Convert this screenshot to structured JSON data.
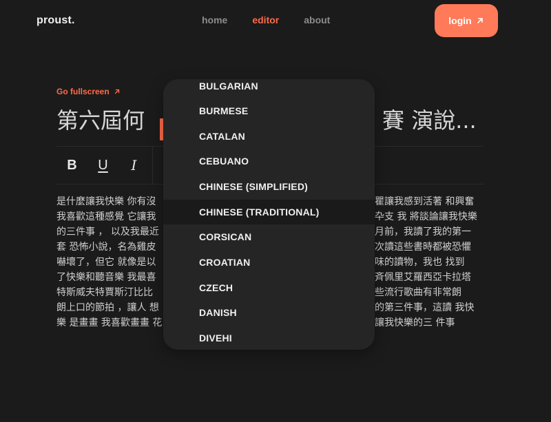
{
  "header": {
    "brand": "proust.",
    "nav": [
      {
        "label": "home",
        "active": false
      },
      {
        "label": "editor",
        "active": true
      },
      {
        "label": "about",
        "active": false
      }
    ],
    "login_label": "login",
    "login_icon": "arrow-up-right-icon"
  },
  "editor": {
    "fullscreen_label": "Go fullscreen",
    "fullscreen_icon": "arrow-up-right-icon",
    "title_left": "第六屆何",
    "title_right": "賽 演說...",
    "toolbar": {
      "bold": "B",
      "underline": "U",
      "italic": "I"
    },
    "body_left": [
      "是什麼讓我快樂 你有沒",
      "我喜歡這種感覺 它讓我",
      "的三件事 ， 以及我最近",
      "套 恐怖小說，名為雞皮",
      "嚇壞了，但它 就像是以",
      "了快樂和聽音樂 我最喜",
      "特斯威夫特賈斯汀比比",
      "朗上口的節拍 ，讓人 想",
      "樂 是畫畫 我喜歡畫畫 花"
    ],
    "body_right": [
      "瞿讓我感到活著 和興奮",
      "卆支 我 將談論讓我快樂",
      "月前，我讀了我的第一",
      "次讀這些書時都被恐懼",
      "味的讀物，我也 找到",
      "斉佩里艾羅西亞卡拉塔",
      "些流行歌曲有非常朗",
      "的第三件事，這讀 我快",
      "讓我快樂的三 件事"
    ]
  },
  "language_dropdown": {
    "options": [
      "BULGARIAN",
      "BURMESE",
      "CATALAN",
      "CEBUANO",
      "CHINESE (SIMPLIFIED)",
      "CHINESE (TRADITIONAL)",
      "CORSICAN",
      "CROATIAN",
      "CZECH",
      "DANISH",
      "DIVEHI"
    ],
    "selected": "CHINESE (TRADITIONAL)"
  },
  "colors": {
    "accent": "#ff6b4a",
    "login_button": "#ff7a59",
    "background": "#1b1b1b",
    "dropdown_bg": "#252525"
  }
}
